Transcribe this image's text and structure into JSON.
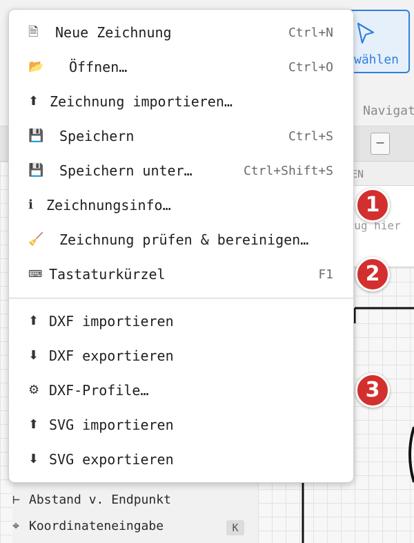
{
  "app": {
    "select_tool_label": "wählen",
    "navigate_tab_label": "Navigat",
    "zoom_out_label": "–",
    "properties_header": "TEN",
    "properties_hint": "zeug hier"
  },
  "left_panel": {
    "items": [
      {
        "glyph": "⊢",
        "label": "Abstand v. Endpunkt"
      },
      {
        "glyph": "⌖",
        "label": "Koordinateneingabe",
        "shortcut": "K"
      }
    ]
  },
  "menu": {
    "items": [
      {
        "icon": "🗎",
        "icon_name": "new-document-icon",
        "label": "Neue Zeichnung",
        "shortcut": "Ctrl+N"
      },
      {
        "icon": "📂",
        "icon_name": "folder-open-icon",
        "label": "Öffnen…",
        "shortcut": "Ctrl+O"
      },
      {
        "icon": "⬆",
        "icon_name": "upload-arrow-icon",
        "label": "Zeichnung importieren…",
        "shortcut": ""
      },
      {
        "icon": "💾",
        "icon_name": "floppy-disk-icon",
        "label": "Speichern",
        "shortcut": "Ctrl+S"
      },
      {
        "icon": "💾",
        "icon_name": "floppy-disk-icon",
        "label": "Speichern unter…",
        "shortcut": "Ctrl+Shift+S"
      },
      {
        "icon": "ℹ",
        "icon_name": "info-icon",
        "label": "Zeichnungsinfo…",
        "shortcut": ""
      },
      {
        "icon": "🧹",
        "icon_name": "broom-icon",
        "label": "Zeichnung prüfen & bereinigen…",
        "shortcut": ""
      },
      {
        "icon": "⌨",
        "icon_name": "keyboard-icon",
        "label": "Tastaturkürzel",
        "shortcut": "F1"
      }
    ],
    "dxf_items": [
      {
        "icon": "⬆",
        "icon_name": "upload-arrow-icon",
        "label": "DXF importieren"
      },
      {
        "icon": "⬇",
        "icon_name": "download-arrow-icon",
        "label": "DXF exportieren"
      },
      {
        "icon": "⚙",
        "icon_name": "gear-icon",
        "label": "DXF-Profile…"
      },
      {
        "icon": "⬆",
        "icon_name": "upload-arrow-icon",
        "label": "SVG importieren"
      },
      {
        "icon": "⬇",
        "icon_name": "download-arrow-icon",
        "label": "SVG exportieren"
      }
    ]
  },
  "callouts": [
    "1",
    "2",
    "3"
  ],
  "colors": {
    "accent": "#2f7fdc",
    "badge": "#d32f2f",
    "separator": "#c9ccd3"
  }
}
